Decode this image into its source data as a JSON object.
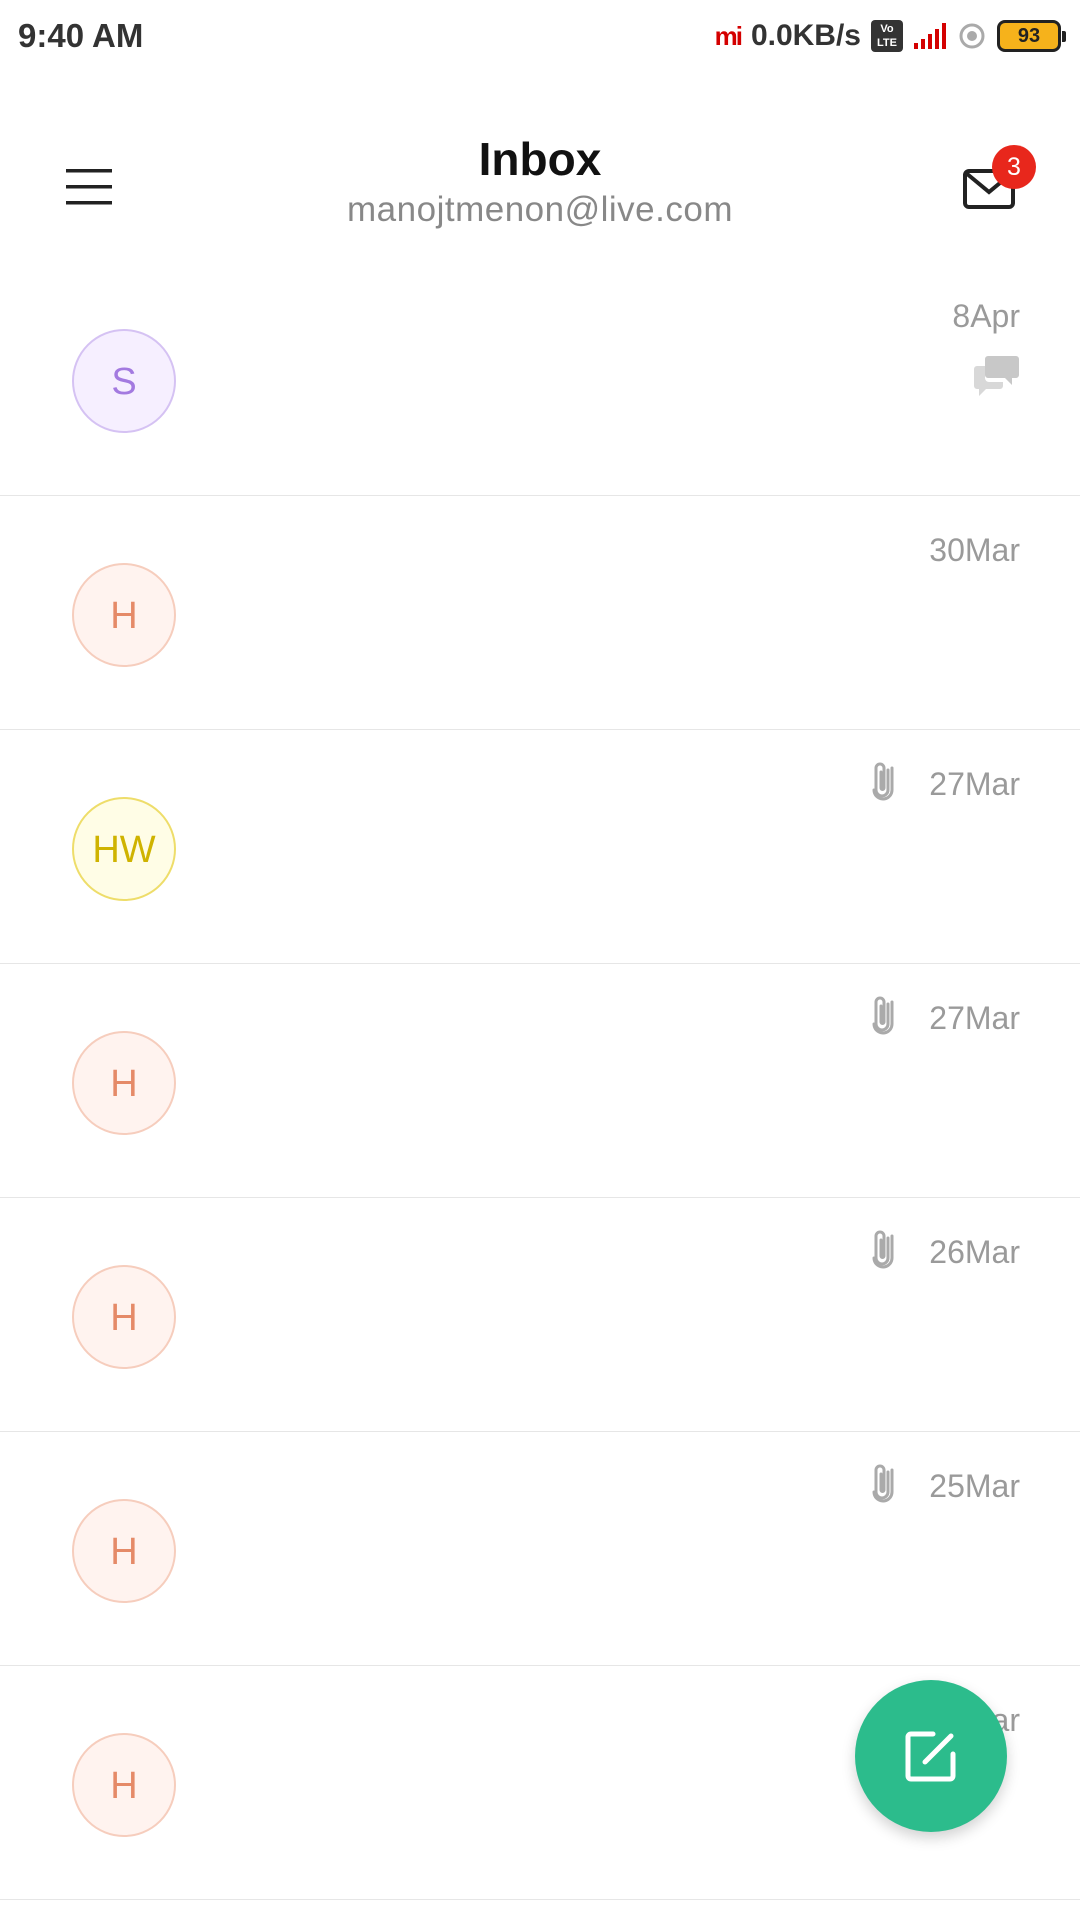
{
  "status_bar": {
    "time": "9:40 AM",
    "carrier_logo": "mi",
    "net_speed": "0.0KB/s",
    "volte_top": "Vo",
    "volte_bottom": "LTE",
    "battery": "93",
    "icons": [
      "mi-logo",
      "volte-icon",
      "signal-icon",
      "sync-icon",
      "battery-icon"
    ]
  },
  "header": {
    "title": "Inbox",
    "account": "manojtmenon@live.com",
    "menu_icon": "hamburger-icon",
    "mail_icon": "mail-icon",
    "unread_count": "3"
  },
  "colors": {
    "accent": "#2cbc8c",
    "badge": "#e8271c",
    "avatar_s": "#a37ae0",
    "avatar_h": "#e58a68",
    "avatar_hw": "#d4b800"
  },
  "mails": [
    {
      "initials": "S",
      "date": "8Apr",
      "has_attachment": false,
      "icon": "conversation-icon",
      "avatar_color": "purple"
    },
    {
      "initials": "H",
      "date": "30Mar",
      "has_attachment": false,
      "avatar_color": "orange"
    },
    {
      "initials": "HW",
      "date": "27Mar",
      "has_attachment": true,
      "avatar_color": "yellow"
    },
    {
      "initials": "H",
      "date": "27Mar",
      "has_attachment": true,
      "avatar_color": "orange"
    },
    {
      "initials": "H",
      "date": "26Mar",
      "has_attachment": true,
      "avatar_color": "orange"
    },
    {
      "initials": "H",
      "date": "25Mar",
      "has_attachment": true,
      "avatar_color": "orange"
    },
    {
      "initials": "H",
      "date": "ar",
      "has_attachment": false,
      "avatar_color": "orange"
    }
  ],
  "compose": {
    "icon": "compose-icon"
  }
}
